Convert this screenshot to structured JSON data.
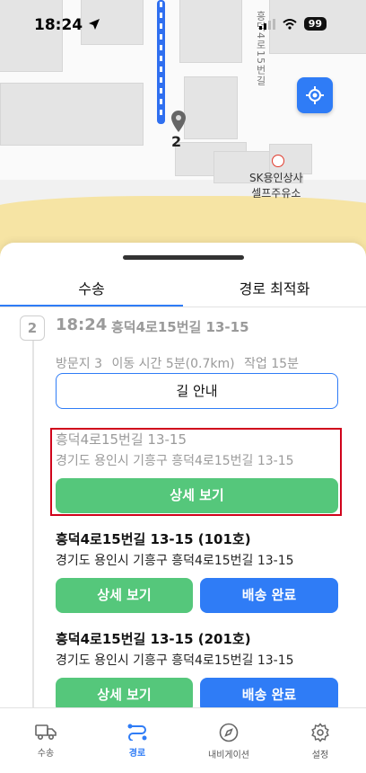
{
  "status_bar": {
    "time": "18:24",
    "battery": "99"
  },
  "map": {
    "pin_label": "2",
    "street_label": "흥덕4로15번길",
    "poi_line1": "SK용인상사",
    "poi_line2": "셀프주유소"
  },
  "tabs": [
    {
      "label": "수송",
      "active": true
    },
    {
      "label": "경로 최적화",
      "active": false
    }
  ],
  "stop": {
    "number": "2",
    "time": "18:24",
    "address": "흥덕4로15번길 13-15",
    "meta": {
      "visits": "방문지 3",
      "travel": "이동 시간 5분(0.7km)",
      "work": "작업 15분"
    },
    "guide_button": "길 안내"
  },
  "items": [
    {
      "title": "흥덕4로15번길 13-15",
      "subtitle": "경기도 용인시 기흥구 흥덕4로15번길 13-15",
      "detail_button": "상세 보기"
    },
    {
      "title": "흥덕4로15번길 13-15 (101호)",
      "subtitle": "경기도 용인시 기흥구 흥덕4로15번길 13-15",
      "detail_button": "상세 보기",
      "complete_button": "배송 완료"
    },
    {
      "title": "흥덕4로15번길 13-15 (201호)",
      "subtitle": "경기도 용인시 기흥구 흥덕4로15번길 13-15",
      "detail_button": "상세 보기",
      "complete_button": "배송 완료"
    }
  ],
  "nav": [
    {
      "label": "수송",
      "icon": "truck-icon",
      "active": false
    },
    {
      "label": "경로",
      "icon": "route-icon",
      "active": true
    },
    {
      "label": "내비게이션",
      "icon": "compass-icon",
      "active": false
    },
    {
      "label": "설정",
      "icon": "gear-icon",
      "active": false
    }
  ],
  "colors": {
    "accent": "#2f7cf6",
    "green": "#55c77b",
    "highlight": "#d0021b"
  }
}
